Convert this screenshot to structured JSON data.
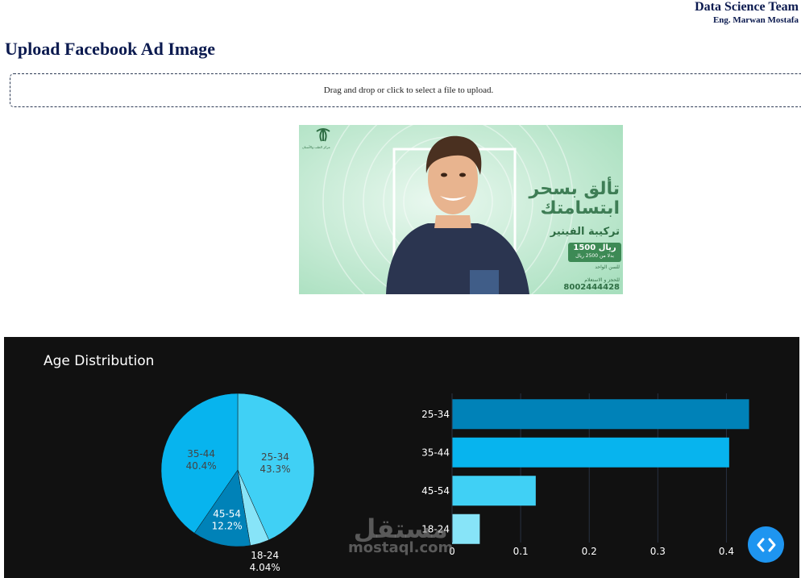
{
  "header": {
    "team": "Data Science Team",
    "author": "Eng. Marwan Mostafa"
  },
  "page_title": "Upload Facebook Ad Image",
  "upload": {
    "prompt": "Drag and drop or click to select a file to upload."
  },
  "ad_image": {
    "headline_line1": "تألق بسحر",
    "headline_line2": "ابتسامتك",
    "service": "تركيبة الفينير",
    "price": "1500 ريال",
    "price_sub": "بدلا من 2500 ريال",
    "note": "للسن الواحد",
    "contact_label": "للحجز و الاستعلام",
    "phone": "8002444428",
    "logo_text": "مركز الطب والأسنان",
    "colors": {
      "bg": "#c9ecd6",
      "shirt": "#2b3550",
      "skin": "#e8b48f",
      "hair": "#4a3020",
      "green": "#3d8a55"
    }
  },
  "watermark": {
    "arabic": "مستقل",
    "latin": "mostaql.com"
  },
  "code_toggle_icon": "code-brackets-icon",
  "colors": {
    "title": "#0b1a4f",
    "panel_bg": "#111111",
    "toggle": "#1e95f0"
  },
  "chart_data": [
    {
      "type": "pie",
      "title": "Age Distribution",
      "slices": [
        {
          "label": "25-34",
          "value": 43.3,
          "value_label": "43.3%",
          "color": "#40d0f5"
        },
        {
          "label": "18-24",
          "value": 4.04,
          "value_label": "4.04%",
          "color": "#87e4f8"
        },
        {
          "label": "45-54",
          "value": 12.2,
          "value_label": "12.2%",
          "color": "#0082b8"
        },
        {
          "label": "35-44",
          "value": 40.4,
          "value_label": "40.4%",
          "color": "#07b4ee"
        }
      ]
    },
    {
      "type": "bar",
      "orientation": "horizontal",
      "categories": [
        "25-34",
        "35-44",
        "45-54",
        "18-24"
      ],
      "values": [
        0.433,
        0.404,
        0.122,
        0.0404
      ],
      "colors": [
        "#0082b8",
        "#07b4ee",
        "#40d0f5",
        "#87e4f8"
      ],
      "xlim": [
        0,
        0.45
      ],
      "xticks": [
        0,
        0.1,
        0.2,
        0.3,
        0.4
      ],
      "xtick_labels": [
        "0",
        "0.1",
        "0.2",
        "0.3",
        "0.4"
      ],
      "grid": true
    }
  ]
}
